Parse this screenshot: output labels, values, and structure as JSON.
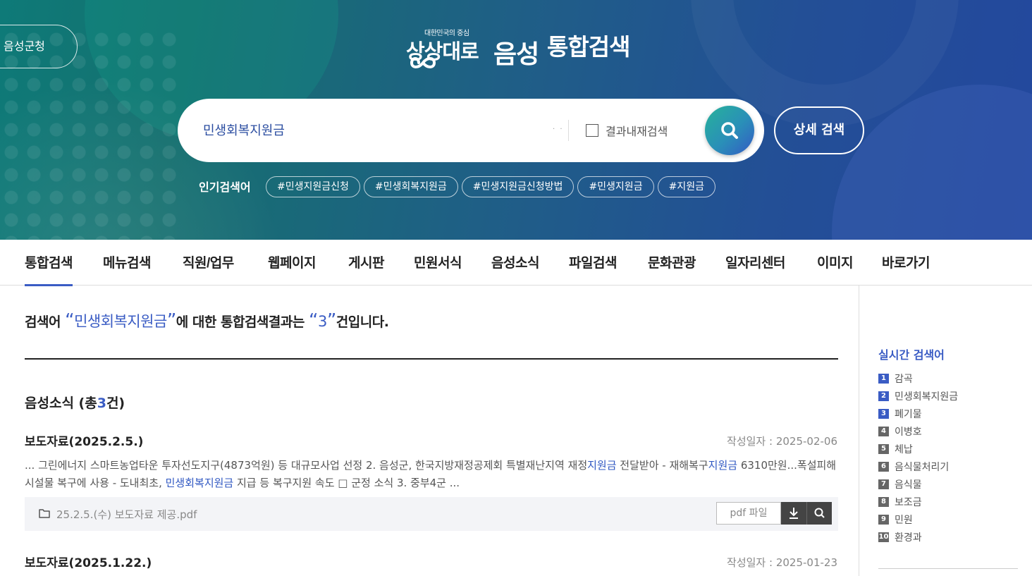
{
  "header": {
    "county_button": "음성군청",
    "logo": {
      "small_text": "대한민국의 중심",
      "brand": "상상대로",
      "city": "음성",
      "title": "통합검색"
    },
    "search": {
      "value": "민생회복지원금",
      "recheck_label": "결과내재검색",
      "recheck_checked": false
    },
    "advanced_button": "상세 검색",
    "popular": {
      "label": "인기검색어",
      "tags": [
        "#민생지원금신청",
        "#민생회복지원금",
        "#민생지원금신청방법",
        "#민생지원금",
        "#지원금"
      ]
    }
  },
  "tabs": [
    {
      "label": "통합검색",
      "active": true
    },
    {
      "label": "메뉴검색"
    },
    {
      "label": "직원/업무"
    },
    {
      "label": "웹페이지"
    },
    {
      "label": "게시판"
    },
    {
      "label": "민원서식"
    },
    {
      "label": "음성소식"
    },
    {
      "label": "파일검색"
    },
    {
      "label": "문화관광"
    },
    {
      "label": "일자리센터"
    },
    {
      "label": "이미지"
    },
    {
      "label": "바로가기"
    }
  ],
  "summary": {
    "prefix": "검색어",
    "open_quote": "“",
    "keyword": "민생회복지원금",
    "close_quote": "”",
    "middle": "에 대한 통합검색결과는",
    "count": "3",
    "suffix": "건입니다."
  },
  "section": {
    "title_prefix": "음성소식 (총",
    "count": "3",
    "title_suffix": "건)"
  },
  "results": [
    {
      "title": "보도자료(2025.2.5.)",
      "date": "작성일자 : 2025-02-06",
      "snippet": {
        "p1": "... 그린에너지 스마트농업타운 투자선도지구(4873억원) 등 대규모사업 선정 2. 음성군, 한국지방재정공제회 특별재난지역 재정",
        "h1": "지원금",
        "p2": " 전달받아 - 재해복구",
        "h2": "지원금",
        "p3": " 6310만원...폭설피해 시설물 복구에 사용 - 도내최초, ",
        "h3": "민생회복지원금",
        "p4": " 지급 등 복구지원 속도 □ 군정 소식 3. 중부4군 ..."
      },
      "file": {
        "name": "25.2.5.(수) 보도자료 제공.pdf",
        "type_label": "pdf 파일"
      }
    },
    {
      "title": "보도자료(2025.1.22.)",
      "date": "작성일자 : 2025-01-23"
    }
  ],
  "sidebar": {
    "title": "실시간 검색어",
    "items": [
      {
        "rank": "1",
        "label": "감곡"
      },
      {
        "rank": "2",
        "label": "민생회복지원금"
      },
      {
        "rank": "3",
        "label": "폐기물"
      },
      {
        "rank": "4",
        "label": "이병호"
      },
      {
        "rank": "5",
        "label": "체납"
      },
      {
        "rank": "6",
        "label": "음식물처리기"
      },
      {
        "rank": "7",
        "label": "음식물"
      },
      {
        "rank": "8",
        "label": "보조금"
      },
      {
        "rank": "9",
        "label": "민원"
      },
      {
        "rank": "10",
        "label": "환경과"
      }
    ]
  },
  "colors": {
    "accent": "#3a5cc4",
    "header_start": "#0e7a78",
    "header_end": "#23489e"
  }
}
